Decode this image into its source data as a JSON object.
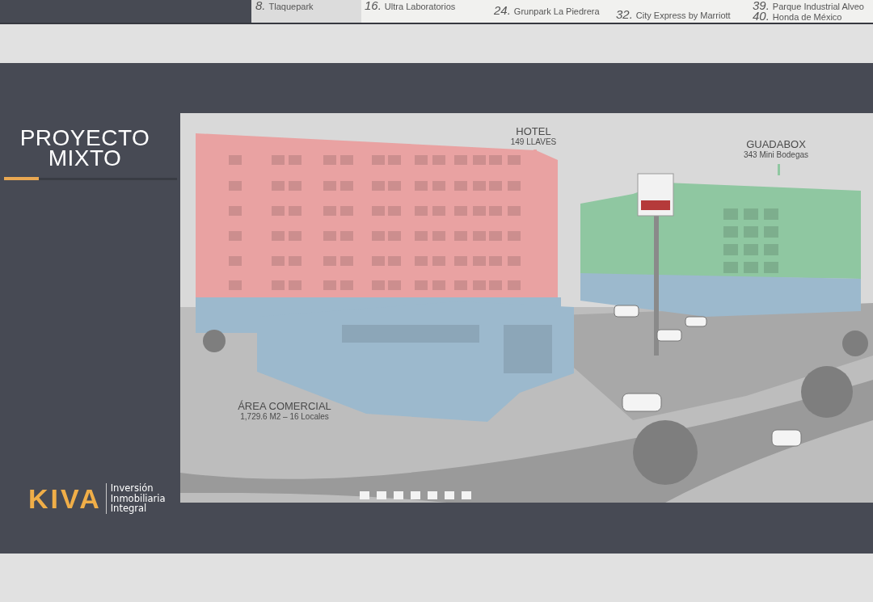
{
  "previous_slide": {
    "map_legend": {
      "columns": [
        [
          {
            "number": "8.",
            "name": "Tlaquepark"
          }
        ],
        [
          {
            "number": "16.",
            "name": "Ultra Laboratorios"
          }
        ],
        [
          {
            "number": "24.",
            "name": "Grunpark La Piedrera"
          }
        ],
        [
          {
            "number": "32.",
            "name": "City Express by Marriott"
          }
        ],
        [
          {
            "number": "39.",
            "name": "Parque Industrial Alveo"
          },
          {
            "number": "40.",
            "name": "Honda de México"
          }
        ]
      ]
    }
  },
  "slide": {
    "title": "PROYECTO MIXTO",
    "render": {
      "zones": [
        {
          "kind": "hotel",
          "color": "#e9a2a2",
          "title": "HOTEL",
          "detail": "149 LLAVES"
        },
        {
          "kind": "storage",
          "color": "#8fc7a1",
          "title": "GUADABOX",
          "detail": "343 Mini Bodegas"
        },
        {
          "kind": "commercial",
          "color": "#9cb9cd",
          "title": "ÁREA COMERCIAL",
          "detail": "1,729.6 M2 – 16 Locales"
        }
      ]
    },
    "logo": {
      "wordmark": "KIVA",
      "tagline": "Inversión Inmobiliaria Integral"
    }
  }
}
